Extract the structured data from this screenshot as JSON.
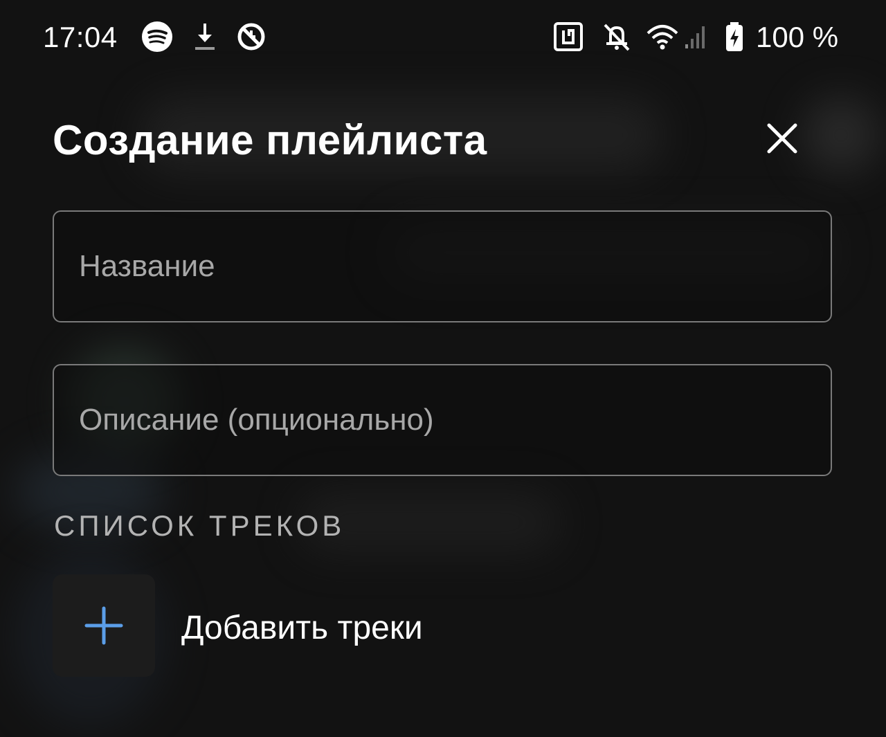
{
  "status_bar": {
    "time": "17:04",
    "left_icons": [
      "spotify-icon",
      "download-icon",
      "vpn-blocked-icon"
    ],
    "right_icons": [
      "nfc-icon",
      "notifications-off-icon",
      "wifi-icon",
      "cellular-signal-icon",
      "battery-charging-icon"
    ],
    "battery_text": "100 %"
  },
  "sheet": {
    "title": "Создание плейлиста",
    "close_icon": "close-icon"
  },
  "form": {
    "name_placeholder": "Название",
    "name_value": "",
    "description_placeholder": "Описание (опционально)",
    "description_value": ""
  },
  "tracks": {
    "section_label": "СПИСОК ТРЕКОВ",
    "add_icon": "plus-icon",
    "add_label": "Добавить треки"
  },
  "colors": {
    "background": "#121212",
    "accent": "#5b9ee8",
    "field_border": "#7a7a7a",
    "placeholder": "#a8a8a8",
    "section_label": "#b3b3b3"
  }
}
